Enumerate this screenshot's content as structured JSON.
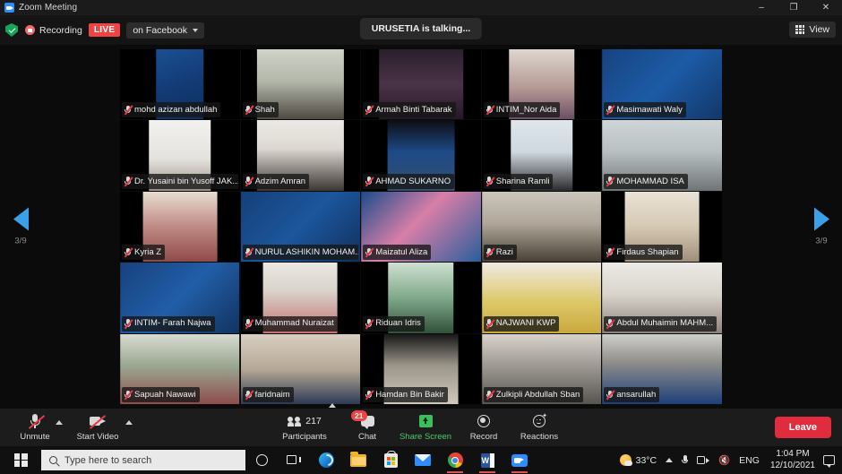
{
  "window": {
    "title": "Zoom Meeting",
    "app_icon": "zoom-icon",
    "minimize": "–",
    "maximize": "❐",
    "close": "✕"
  },
  "topbar": {
    "shield_icon": "encryption-shield-icon",
    "recording_icon": "recording-icon",
    "recording_label": "Recording",
    "live_badge": "LIVE",
    "stream_target": "on Facebook",
    "stream_caret_icon": "chevron-down-icon",
    "talking_notice": "URUSETIA is talking...",
    "view_icon": "grid-view-icon",
    "view_label": "View"
  },
  "gallery": {
    "prev_arrow_icon": "chevron-left-icon",
    "next_arrow_icon": "chevron-right-icon",
    "page_indicator": "3/9",
    "mic_muted_icon": "microphone-muted-icon",
    "participants": [
      {
        "name": "mohd azizan abdullah",
        "muted": true,
        "thumb": "portrait-blue-poster"
      },
      {
        "name": "Shah",
        "muted": true,
        "thumb": "office-ceiling-lights"
      },
      {
        "name": "Armah Binti Tabarak",
        "muted": true,
        "thumb": "dark-closeup-hijab"
      },
      {
        "name": "INTIM_Nor Aida",
        "muted": true,
        "thumb": "woman-purple-hijab"
      },
      {
        "name": "Masimawati Waly",
        "muted": true,
        "thumb": "woman-blue-virtual-bg"
      },
      {
        "name": "Dr. Yusaini bin Yusoff JAK...",
        "muted": true,
        "thumb": "man-white-room"
      },
      {
        "name": "Adzim Amran",
        "muted": true,
        "thumb": "young-man-white-wall"
      },
      {
        "name": "AHMAD SUKARNO",
        "muted": true,
        "thumb": "man-songkok-blue-bg"
      },
      {
        "name": "Sharina Ramli",
        "muted": true,
        "thumb": "woman-black-hijab-office"
      },
      {
        "name": "MOHAMMAD ISA",
        "muted": true,
        "thumb": "man-face-mask"
      },
      {
        "name": "Kyria Z",
        "muted": true,
        "thumb": "woman-red-hijab-mask"
      },
      {
        "name": "NURUL ASHIKIN MOHAM...",
        "muted": true,
        "thumb": "woman-headset-blue-bg"
      },
      {
        "name": "Maizatul Aliza",
        "muted": true,
        "thumb": "woman-pink-hijab-mask"
      },
      {
        "name": "Razi",
        "muted": true,
        "thumb": "man-glasses-office"
      },
      {
        "name": "Firdaus Shapian",
        "muted": true,
        "thumb": "man-bookshelf-room"
      },
      {
        "name": "INTIM- Farah Najwa",
        "muted": true,
        "thumb": "woman-headset-blue-bg-2"
      },
      {
        "name": "Muhammad Nuraizat",
        "muted": true,
        "thumb": "man-pink-shirt-glasses"
      },
      {
        "name": "Riduan Idris",
        "muted": true,
        "thumb": "man-outdoor-green"
      },
      {
        "name": "NAJWANI KWP",
        "muted": true,
        "thumb": "woman-yellow-hijab"
      },
      {
        "name": "Abdul Muhaimin MAHM...",
        "muted": true,
        "thumb": "man-white-kopiah"
      },
      {
        "name": "Sapuah Nawawi",
        "muted": true,
        "thumb": "woman-red-hijab-window"
      },
      {
        "name": "faridnaim",
        "muted": true,
        "thumb": "man-navy-mask-lobby"
      },
      {
        "name": "Hamdan Bin Bakir",
        "muted": true,
        "thumb": "man-songkok-glasses"
      },
      {
        "name": "Zulkipli Abdullah Sban",
        "muted": true,
        "thumb": "man-in-car"
      },
      {
        "name": "ansarullah",
        "muted": true,
        "thumb": "man-songkok-blue-shirt"
      }
    ]
  },
  "controls": {
    "mute": {
      "label": "Unmute",
      "icon": "microphone-muted-icon",
      "caret_icon": "chevron-up-icon"
    },
    "video": {
      "label": "Start Video",
      "icon": "camera-off-icon",
      "caret_icon": "chevron-up-icon"
    },
    "participants": {
      "label": "Participants",
      "count": "217",
      "icon": "participants-icon",
      "caret_icon": "chevron-up-icon"
    },
    "chat": {
      "label": "Chat",
      "badge": "21",
      "icon": "chat-bubble-icon"
    },
    "share": {
      "label": "Share Screen",
      "icon": "share-screen-icon"
    },
    "record": {
      "label": "Record",
      "icon": "record-icon"
    },
    "reactions": {
      "label": "Reactions",
      "icon": "reactions-icon"
    },
    "leave": {
      "label": "Leave"
    }
  },
  "taskbar": {
    "start_icon": "windows-start-icon",
    "search_placeholder": "Type here to search",
    "search_icon": "search-icon",
    "items": [
      {
        "name": "cortana-icon"
      },
      {
        "name": "task-view-icon"
      },
      {
        "name": "edge-icon"
      },
      {
        "name": "file-explorer-icon"
      },
      {
        "name": "microsoft-store-icon"
      },
      {
        "name": "mail-icon"
      },
      {
        "name": "chrome-icon"
      },
      {
        "name": "word-icon"
      },
      {
        "name": "zoom-taskbar-icon"
      }
    ],
    "word_letter": "W",
    "weather": "33°C",
    "weather_icon": "partly-sunny-icon",
    "tray_expand_icon": "chevron-up-icon",
    "tray_mic_icon": "microphone-icon",
    "tray_camera_icon": "camera-icon",
    "tray_volume_icon": "volume-muted-icon",
    "volume_glyph": "🔇",
    "language": "ENG",
    "time": "1:04 PM",
    "date": "12/10/2021",
    "notification_icon": "notification-center-icon"
  },
  "colors": {
    "accent_blue": "#2d8cff",
    "live_red": "#ef4444",
    "leave_red": "#e02c3c",
    "share_green": "#3bbf5b",
    "arrow_blue": "#3aa0e8"
  }
}
